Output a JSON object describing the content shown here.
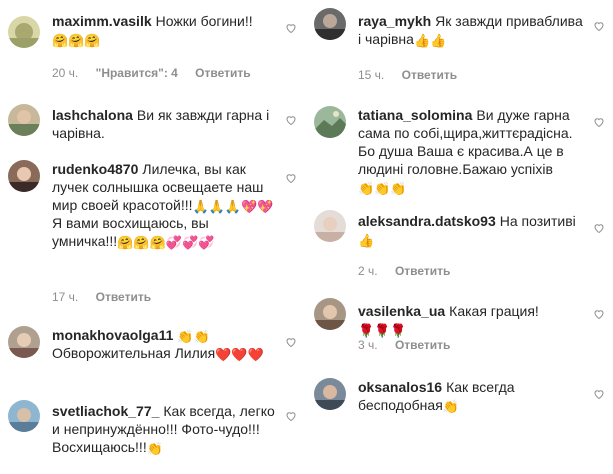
{
  "left": [
    {
      "user": "maximm.vasilk",
      "text": "Ножки богини!!",
      "emoji": "🤗🤗🤗",
      "time": "20 ч.",
      "likes": "\"Нравится\": 4",
      "reply": "Ответить"
    },
    {
      "user": "lashchalona",
      "text": "Ви як завжди гарна і чарівна."
    },
    {
      "user": "rudenko4870",
      "text": "Лилечка, вы как лучек солнышка освещаете наш мир своей красотой!!!",
      "emoji": "🙏🙏🙏💖💖",
      "text2": "Я вами восхищаюсь, вы умничка!!!",
      "emoji2": "🤗🤗🤗💞💞💞",
      "time": "17 ч.",
      "reply": "Ответить"
    },
    {
      "user": "monakhovaolga11",
      "emoji": "👏👏",
      "text": "Обворожительная Лилия",
      "emoji2": "❤️❤️❤️"
    },
    {
      "user": "svetliachok_77_",
      "text": "Как всегда, легко и непринуждённо!!! Фото-чудо!!! Восхищаюсь!!!",
      "emoji": "👏"
    }
  ],
  "right": [
    {
      "user": "raya_mykh",
      "text": "Як завжди приваблива і чарівна",
      "emoji": "👍👍",
      "time": "15 ч.",
      "reply": "Ответить"
    },
    {
      "user": "tatiana_solomina",
      "text": "Ви дуже гарна сама по собі,щира,життєрадісна. Бо душа Ваша є красива.А це в людині головне.Бажаю успіхів",
      "emoji": "👏👏👏"
    },
    {
      "user": "aleksandra.datsko93",
      "text": "На позитиві",
      "emoji": "👍",
      "time": "2 ч.",
      "reply": "Ответить"
    },
    {
      "user": "vasilenka_ua",
      "text": "Какая грация!",
      "emoji": "🌹🌹🌹",
      "time": "3 ч.",
      "reply": "Ответить"
    },
    {
      "user": "oksanalos16",
      "text": "Как всегда бесподобная",
      "emoji": "👏"
    }
  ],
  "icons": {
    "like": "heart-outline-icon"
  },
  "colors": {
    "meta": "#8e8e8e",
    "text": "#262626"
  }
}
